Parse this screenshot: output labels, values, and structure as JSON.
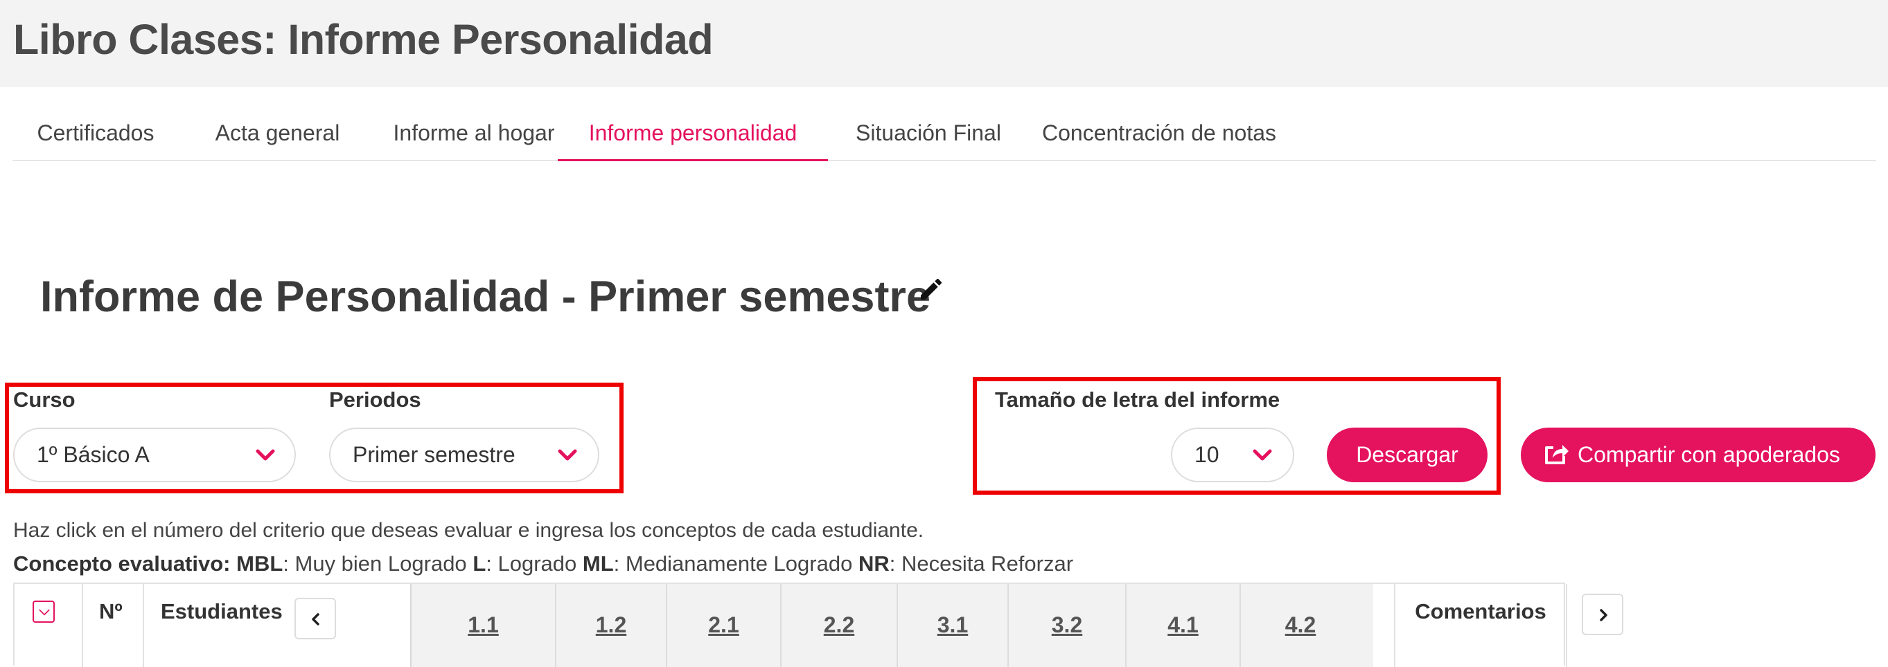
{
  "header": {
    "title": "Libro Clases: Informe Personalidad"
  },
  "tabs": [
    {
      "label": "Certificados"
    },
    {
      "label": "Acta general"
    },
    {
      "label": "Informe al hogar"
    },
    {
      "label": "Informe personalidad",
      "active": true
    },
    {
      "label": "Situación Final"
    },
    {
      "label": "Concentración de notas"
    }
  ],
  "section": {
    "title": "Informe de Personalidad - Primer semestre",
    "edit_icon": "pencil-icon"
  },
  "filters": {
    "curso": {
      "label": "Curso",
      "value": "1º Básico A"
    },
    "periodos": {
      "label": "Periodos",
      "value": "Primer semestre"
    }
  },
  "font_size": {
    "label": "Tamaño de letra del informe",
    "value": "10"
  },
  "actions": {
    "download": "Descargar",
    "share": "Compartir con apoderados",
    "share_icon": "share-icon"
  },
  "instructions": "Haz click en el número del criterio que deseas evaluar e ingresa los conceptos de cada estudiante.",
  "legend": {
    "prefix": "Concepto evaluativo:",
    "items": [
      {
        "code": "MBL",
        "meaning": ": Muy bien Logrado"
      },
      {
        "code": "L",
        "meaning": ": Logrado"
      },
      {
        "code": "ML",
        "meaning": ": Medianamente Logrado"
      },
      {
        "code": "NR",
        "meaning": ": Necesita Reforzar"
      }
    ]
  },
  "table": {
    "col_number": "Nº",
    "col_students": "Estudiantes",
    "criteria": [
      "1.1",
      "1.2",
      "2.1",
      "2.2",
      "3.1",
      "3.2",
      "4.1",
      "4.2"
    ],
    "col_comments": "Comentarios"
  },
  "colors": {
    "accent": "#e5125e",
    "highlight_box": "#ee0000",
    "header_bg": "#f3f3f3"
  }
}
